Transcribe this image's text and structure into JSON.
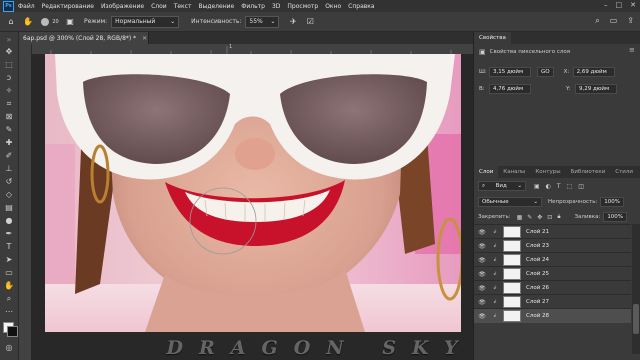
{
  "menu": {
    "logo": "Ps",
    "items": [
      "Файл",
      "Редактирование",
      "Изображение",
      "Слои",
      "Текст",
      "Выделение",
      "Фильтр",
      "3D",
      "Просмотр",
      "Окно",
      "Справка"
    ]
  },
  "options": {
    "mode_label": "Режим:",
    "mode_value": "Нормальный",
    "intensity_label": "Интенсивность:",
    "intensity_value": "55%",
    "brush_size": "20"
  },
  "document": {
    "tab_title": "6ap.psd @ 300% (Слой 28, RGB/8*) *",
    "ruler_marks": [
      "1"
    ]
  },
  "properties": {
    "tab": "Свойства",
    "header": "Свойства пиксельного слоя",
    "w_label": "Ш:",
    "w_value": "3,15 дюйм",
    "h_label": "В:",
    "h_value": "4,76 дюйм",
    "x_label": "X:",
    "x_value": "2,69 дюйм",
    "y_label": "Y:",
    "y_value": "9,29 дюйм",
    "link_label": "GO"
  },
  "layers_panel": {
    "tabs": [
      "Слои",
      "Каналы",
      "Контуры",
      "Библиотеки",
      "Стили"
    ],
    "filter_value": "Вид",
    "blend_mode": "Обычные",
    "opacity_label": "Непрозрачность:",
    "opacity_value": "100%",
    "lock_label": "Закрепить:",
    "fill_label": "Заливка:",
    "fill_value": "100%",
    "layers": [
      {
        "name": "Слой 21",
        "selected": false
      },
      {
        "name": "Слой 23",
        "selected": false
      },
      {
        "name": "Слой 24",
        "selected": false
      },
      {
        "name": "Слой 25",
        "selected": false
      },
      {
        "name": "Слой 26",
        "selected": false
      },
      {
        "name": "Слой 27",
        "selected": false
      },
      {
        "name": "Слой 28",
        "selected": true
      }
    ]
  },
  "watermark": "DRAGON SKY",
  "colors": {
    "accent": "#31a8ff",
    "panel": "#3a3a3a",
    "canvas_bg": "#282828"
  }
}
